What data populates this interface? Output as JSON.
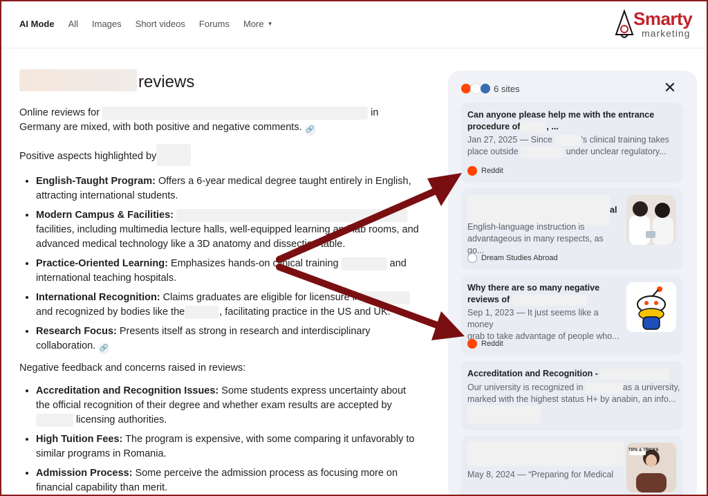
{
  "nav": {
    "tabs": [
      {
        "label": "AI Mode",
        "active": true
      },
      {
        "label": "All"
      },
      {
        "label": "Images"
      },
      {
        "label": "Short videos"
      },
      {
        "label": "Forums"
      },
      {
        "label": "More"
      }
    ]
  },
  "logo": {
    "name": "Smarty",
    "sub": "marketing"
  },
  "main": {
    "heading_suffix": "reviews",
    "intro_a": "Online reviews for",
    "intro_b": "in",
    "intro_c": "Germany are mixed, with both positive and negative comments.",
    "positive_heading": "Positive aspects highlighted by",
    "positives": [
      {
        "term": "English-Taught Program:",
        "text": " Offers a 6-year medical degree taught entirely in English, attracting international students."
      },
      {
        "term": "Modern Campus & Facilities:",
        "text": "facilities, including multimedia lecture halls, well-equipped learning and lab rooms, and advanced medical technology like a 3D anatomy and dissection table."
      },
      {
        "term": "Practice-Oriented Learning:",
        "text_a": " Emphasizes hands-on clinical training",
        "text_b": "and international teaching hospitals."
      },
      {
        "term": "International Recognition:",
        "text_a": " Claims graduates are eligible for licensure in",
        "text_b": "and recognized by bodies like the",
        "text_c": ", facilitating practice in the US and UK."
      },
      {
        "term": "Research Focus:",
        "text": " Presents itself as strong in research and interdisciplinary collaboration."
      }
    ],
    "negative_heading": "Negative feedback and concerns raised in reviews:",
    "negatives": [
      {
        "term": "Accreditation and Recognition Issues:",
        "text_a": " Some students express uncertainty about the official recognition of their degree and whether exam results are accepted by",
        "text_b": "licensing authorities."
      },
      {
        "term": "High Tuition Fees:",
        "text": " The program is expensive, with some comparing it unfavorably to similar programs in Romania."
      },
      {
        "term": "Admission Process:",
        "text": " Some perceive the admission process as focusing more on financial capability than merit."
      }
    ]
  },
  "panel": {
    "sites_label": "6 sites",
    "cards": [
      {
        "title_a": "Can anyone please help me with the entrance",
        "title_b": "procedure of",
        "title_c": ", ...",
        "snip_a": "Jan 27, 2025 — Since",
        "snip_b": "'s clinical training takes",
        "snip_c": "place outside",
        "snip_d": "under unclear regulatory...",
        "source": "Reddit"
      },
      {
        "title_tail": "al",
        "snip_a": "English-language instruction is",
        "snip_b": "advantageous in many respects, as go...",
        "source": "Dream Studies Abroad"
      },
      {
        "title_a": "Why there are so many negative",
        "title_b": "reviews of",
        "snip_a": "Sep 1, 2023 — It just seems like a money",
        "snip_b": "grab to take advantage of people who...",
        "source": "Reddit"
      },
      {
        "title_a": "Accreditation and Recognition -",
        "snip_a": "Our university is recognized in",
        "snip_b": "as a university,",
        "snip_c": "marked with the highest status H+ by anabin, an info..."
      },
      {
        "snip_a": "May 8, 2024 — “Preparing for Medical",
        "thumb_text": "TIPS & TRICKS"
      }
    ]
  },
  "colors": {
    "accent": "#7a0f12",
    "reddit": "#ff4500",
    "logo": "#c0222a"
  }
}
